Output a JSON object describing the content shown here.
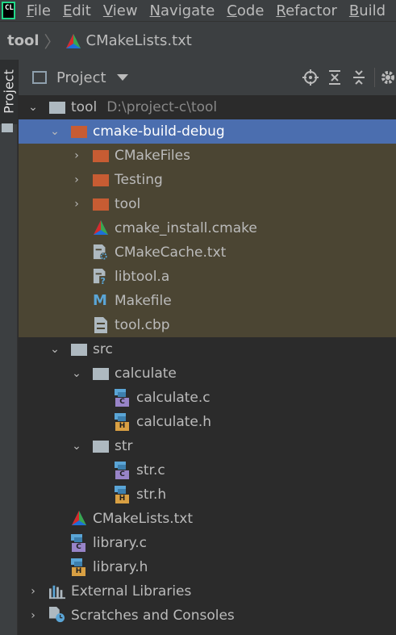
{
  "menu": {
    "app_logo": "CL",
    "items": [
      {
        "u": "F",
        "rest": "ile"
      },
      {
        "u": "E",
        "rest": "dit"
      },
      {
        "u": "V",
        "rest": "iew"
      },
      {
        "u": "N",
        "rest": "avigate"
      },
      {
        "u": "C",
        "rest": "ode"
      },
      {
        "u": "R",
        "rest": "efactor"
      },
      {
        "u": "B",
        "rest": "uild"
      }
    ]
  },
  "breadcrumb": {
    "root": "tool",
    "file": "CMakeLists.txt"
  },
  "left_strip": {
    "project_tab": "Project"
  },
  "tool_window": {
    "title": "Project",
    "icons": [
      "locate-icon",
      "expand-all-icon",
      "collapse-all-icon",
      "gear-icon"
    ]
  },
  "tree": [
    {
      "name": "tool",
      "path": "D:\\project-c\\tool",
      "icon": "folder-gray",
      "arrow": "down",
      "state": "normal"
    },
    {
      "name": "cmake-build-debug",
      "icon": "folder-orange",
      "arrow": "down",
      "state": "selected"
    },
    {
      "name": "CMakeFiles",
      "icon": "folder-orange",
      "arrow": "right",
      "state": "excluded"
    },
    {
      "name": "Testing",
      "icon": "folder-orange",
      "arrow": "right",
      "state": "excluded"
    },
    {
      "name": "tool",
      "icon": "folder-orange",
      "arrow": "right",
      "state": "excluded"
    },
    {
      "name": "cmake_install.cmake",
      "icon": "cmake-triangle",
      "state": "excluded"
    },
    {
      "name": "CMakeCache.txt",
      "icon": "file-settings",
      "state": "excluded"
    },
    {
      "name": "libtool.a",
      "icon": "file-unknown",
      "state": "excluded"
    },
    {
      "name": "Makefile",
      "icon": "makefile-m",
      "state": "excluded"
    },
    {
      "name": "tool.cbp",
      "icon": "file-text",
      "state": "excluded"
    },
    {
      "name": "src",
      "icon": "folder-gray",
      "arrow": "down",
      "state": "normal"
    },
    {
      "name": "calculate",
      "icon": "folder-gray",
      "arrow": "down",
      "state": "normal"
    },
    {
      "name": "calculate.c",
      "icon": "c-source",
      "badge": "C",
      "state": "normal"
    },
    {
      "name": "calculate.h",
      "icon": "c-header",
      "badge": "H",
      "state": "normal"
    },
    {
      "name": "str",
      "icon": "folder-gray",
      "arrow": "down",
      "state": "normal"
    },
    {
      "name": "str.c",
      "icon": "c-source",
      "badge": "C",
      "state": "normal"
    },
    {
      "name": "str.h",
      "icon": "c-header",
      "badge": "H",
      "state": "normal"
    },
    {
      "name": "CMakeLists.txt",
      "icon": "cmake-triangle",
      "state": "normal"
    },
    {
      "name": "library.c",
      "icon": "c-source",
      "badge": "C",
      "state": "normal"
    },
    {
      "name": "library.h",
      "icon": "c-header",
      "badge": "H",
      "state": "normal"
    },
    {
      "name": "External Libraries",
      "icon": "libraries",
      "arrow": "right",
      "state": "normal"
    },
    {
      "name": "Scratches and Consoles",
      "icon": "scratches",
      "arrow": "right",
      "state": "normal"
    }
  ],
  "colors": {
    "selection": "#4b6eaf",
    "excluded_bg": "#4b4533",
    "folder_orange": "#c75c33",
    "folder_gray": "#aeb9c0",
    "c_badge": "#9884c8",
    "h_badge": "#d9a043"
  }
}
